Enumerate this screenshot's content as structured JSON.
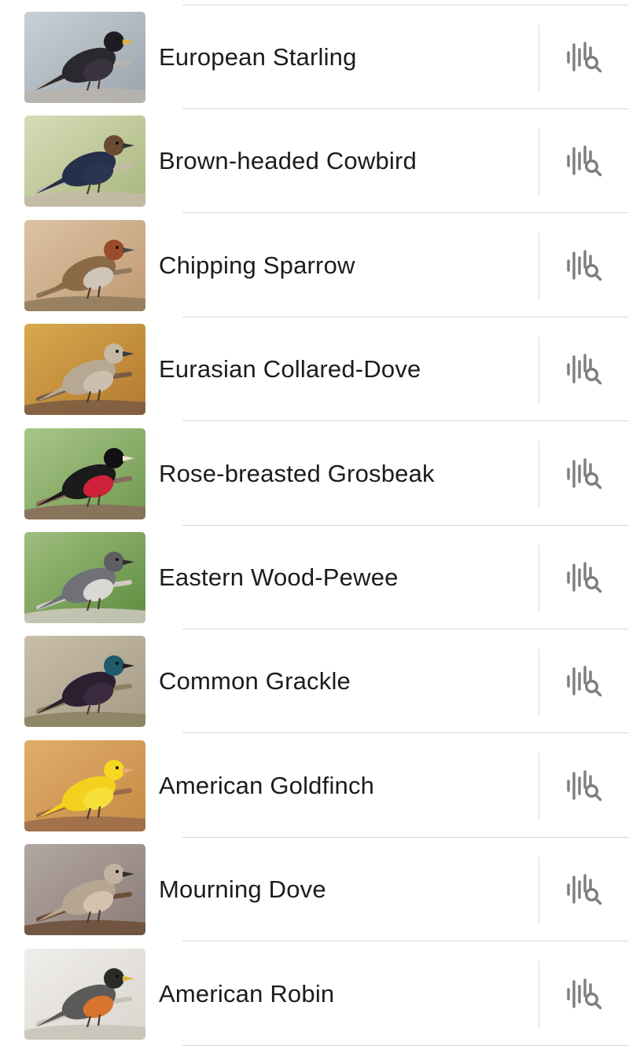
{
  "birds": [
    {
      "name": "European Starling",
      "icon": "sound-search-icon",
      "photo": {
        "bg": "#9aa4ad",
        "bg2": "#c9d0d6",
        "body": "#2a2a2e",
        "head": "#1e1e22",
        "breast": "#3a3340",
        "beak": "#e3b23c",
        "perch": "#b9b4ad"
      }
    },
    {
      "name": "Brown-headed Cowbird",
      "icon": "sound-search-icon",
      "photo": {
        "bg": "#a9b77e",
        "bg2": "#d7dcb8",
        "body": "#26304a",
        "head": "#6b4a33",
        "breast": "#2b3553",
        "beak": "#333333",
        "perch": "#c6b9a8"
      }
    },
    {
      "name": "Chipping Sparrow",
      "icon": "sound-search-icon",
      "photo": {
        "bg": "#c09a72",
        "bg2": "#dcc2a4",
        "body": "#8b6a48",
        "head": "#9a4b2a",
        "breast": "#cfc6b8",
        "beak": "#4a4a4a",
        "perch": "#8f7a5c"
      }
    },
    {
      "name": "Eurasian Collared-Dove",
      "icon": "sound-search-icon",
      "photo": {
        "bg": "#b07a2e",
        "bg2": "#d9a84e",
        "body": "#b7a893",
        "head": "#c5b8a5",
        "breast": "#cbbfae",
        "beak": "#3c3c3c",
        "perch": "#7a5a42"
      }
    },
    {
      "name": "Rose-breasted Grosbeak",
      "icon": "sound-search-icon",
      "photo": {
        "bg": "#6f9a4e",
        "bg2": "#a9c58a",
        "body": "#1b1b1b",
        "head": "#111111",
        "breast": "#d0213a",
        "beak": "#efe6cf",
        "perch": "#8a6a5a"
      }
    },
    {
      "name": "Eastern Wood-Pewee",
      "icon": "sound-search-icon",
      "photo": {
        "bg": "#5e8c3e",
        "bg2": "#9fbe7e",
        "body": "#6f7176",
        "head": "#5d5f64",
        "breast": "#d8d8d4",
        "beak": "#2e2e2e",
        "perch": "#cfcac2"
      }
    },
    {
      "name": "Common Grackle",
      "icon": "sound-search-icon",
      "photo": {
        "bg": "#a49a86",
        "bg2": "#c9bfa8",
        "body": "#2a2030",
        "head": "#1f5a6a",
        "breast": "#3b2a3e",
        "beak": "#1e1e1e",
        "perch": "#8a8060"
      }
    },
    {
      "name": "American Goldfinch",
      "icon": "sound-search-icon",
      "photo": {
        "bg": "#c58a45",
        "bg2": "#e0ad6a",
        "body": "#f2d21c",
        "head": "#f5d81f",
        "breast": "#f7df3a",
        "beak": "#e8a97a",
        "perch": "#9a6b4a"
      }
    },
    {
      "name": "Mourning Dove",
      "icon": "sound-search-icon",
      "photo": {
        "bg": "#8a7c78",
        "bg2": "#b3a7a2",
        "body": "#b6a590",
        "head": "#c2b3a0",
        "breast": "#d3c2ad",
        "beak": "#2e2e2e",
        "perch": "#6b4c36"
      }
    },
    {
      "name": "American Robin",
      "icon": "sound-search-icon",
      "photo": {
        "bg": "#d9d6cf",
        "bg2": "#f0eeea",
        "body": "#5c5a58",
        "head": "#2a2a2a",
        "breast": "#d9742e",
        "beak": "#e0b43a",
        "perch": "#c8c2b6"
      }
    }
  ]
}
